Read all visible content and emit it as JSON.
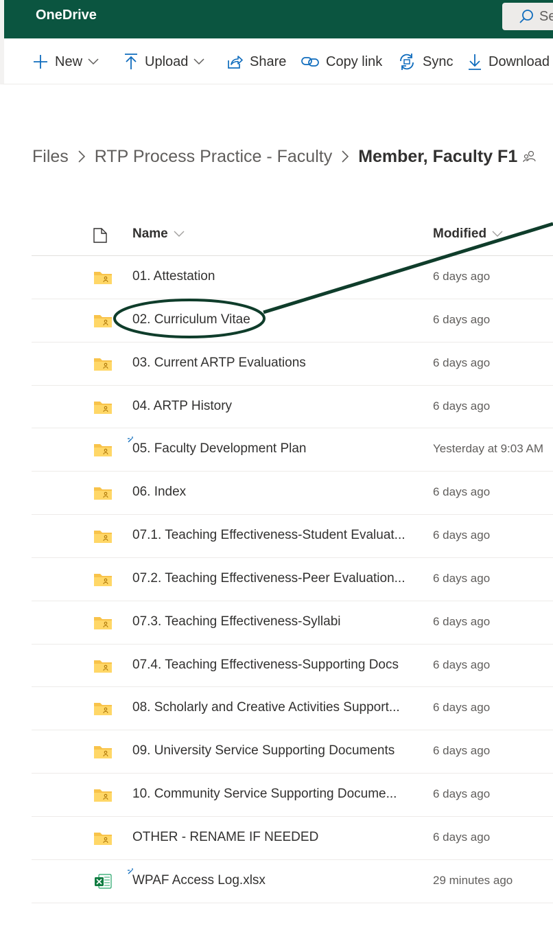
{
  "app": {
    "title": "OneDrive"
  },
  "search": {
    "placeholder": "Se"
  },
  "toolbar": {
    "new_label": "New",
    "upload_label": "Upload",
    "share_label": "Share",
    "copylink_label": "Copy link",
    "sync_label": "Sync",
    "download_label": "Download"
  },
  "breadcrumb": {
    "root": "Files",
    "parent": "RTP Process Practice - Faculty",
    "current": "Member, Faculty F1"
  },
  "list": {
    "col_name": "Name",
    "col_modified": "Modified",
    "rows": [
      {
        "name": "01. Attestation",
        "modified": "6 days ago",
        "type": "folder",
        "new": false
      },
      {
        "name": "02. Curriculum Vitae",
        "modified": "6 days ago",
        "type": "folder",
        "new": false,
        "highlighted": true
      },
      {
        "name": "03. Current ARTP Evaluations",
        "modified": "6 days ago",
        "type": "folder",
        "new": false
      },
      {
        "name": "04. ARTP History",
        "modified": "6 days ago",
        "type": "folder",
        "new": false
      },
      {
        "name": "05. Faculty Development Plan",
        "modified": "Yesterday at 9:03 AM",
        "type": "folder",
        "new": true
      },
      {
        "name": "06. Index",
        "modified": "6 days ago",
        "type": "folder",
        "new": false
      },
      {
        "name": "07.1. Teaching Effectiveness-Student Evaluat...",
        "modified": "6 days ago",
        "type": "folder",
        "new": false
      },
      {
        "name": "07.2. Teaching Effectiveness-Peer Evaluation...",
        "modified": "6 days ago",
        "type": "folder",
        "new": false
      },
      {
        "name": "07.3. Teaching Effectiveness-Syllabi",
        "modified": "6 days ago",
        "type": "folder",
        "new": false
      },
      {
        "name": "07.4. Teaching Effectiveness-Supporting Docs",
        "modified": "6 days ago",
        "type": "folder",
        "new": false
      },
      {
        "name": "08. Scholarly and Creative Activities Support...",
        "modified": "6 days ago",
        "type": "folder",
        "new": false
      },
      {
        "name": "09. University Service Supporting Documents",
        "modified": "6 days ago",
        "type": "folder",
        "new": false
      },
      {
        "name": "10. Community Service Supporting Docume...",
        "modified": "6 days ago",
        "type": "folder",
        "new": false
      },
      {
        "name": "OTHER - RENAME IF NEEDED",
        "modified": "6 days ago",
        "type": "folder",
        "new": false
      },
      {
        "name": "WPAF Access Log.xlsx",
        "modified": "29 minutes ago",
        "type": "excel",
        "new": true
      }
    ]
  },
  "icons": {
    "folder": "shared-folder-icon",
    "excel": "excel-file-icon",
    "new": "new-item-sparkle-icon",
    "shared": "people-shared-icon"
  },
  "colors": {
    "suite_bar": "#0b5540",
    "folder_yellow": "#f8c34a",
    "accent_blue": "#0f6cbd",
    "annotation": "#0f3d2b",
    "excel_green": "#107c41"
  }
}
